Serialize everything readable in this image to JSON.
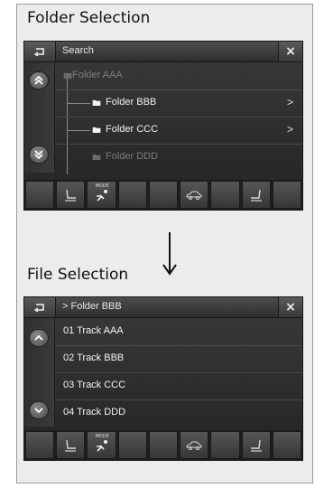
{
  "folder_section": {
    "heading": "Folder Selection",
    "bar_title": "Search",
    "close_label": "×",
    "rows": [
      {
        "label": "Folder AAA",
        "dim": true,
        "chev": ""
      },
      {
        "label": "Folder BBB",
        "dim": false,
        "chev": ">"
      },
      {
        "label": "Folder CCC",
        "dim": false,
        "chev": ">"
      },
      {
        "label": "Folder DDD",
        "dim": true,
        "chev": ""
      }
    ]
  },
  "file_section": {
    "heading": "File Selection",
    "bar_title": "> Folder BBB",
    "close_label": "×",
    "rows": [
      {
        "label": "01 Track AAA"
      },
      {
        "label": "02 Track BBB"
      },
      {
        "label": "03 Track CCC"
      },
      {
        "label": "04 Track DDD"
      }
    ]
  },
  "bottom_bar_icons": [
    "blank",
    "seat-icon",
    "mode-fan-icon",
    "blank",
    "blank",
    "car-icon",
    "blank",
    "seat-icon",
    "blank"
  ],
  "bottom_bar_mode_label": "MODE",
  "icons": {
    "back": "back-arrow-icon",
    "close": "close-icon",
    "scroll_up": "scroll-up-icon",
    "scroll_down": "scroll-down-icon",
    "folder": "folder-icon",
    "flow_arrow": "down-arrow-icon"
  }
}
